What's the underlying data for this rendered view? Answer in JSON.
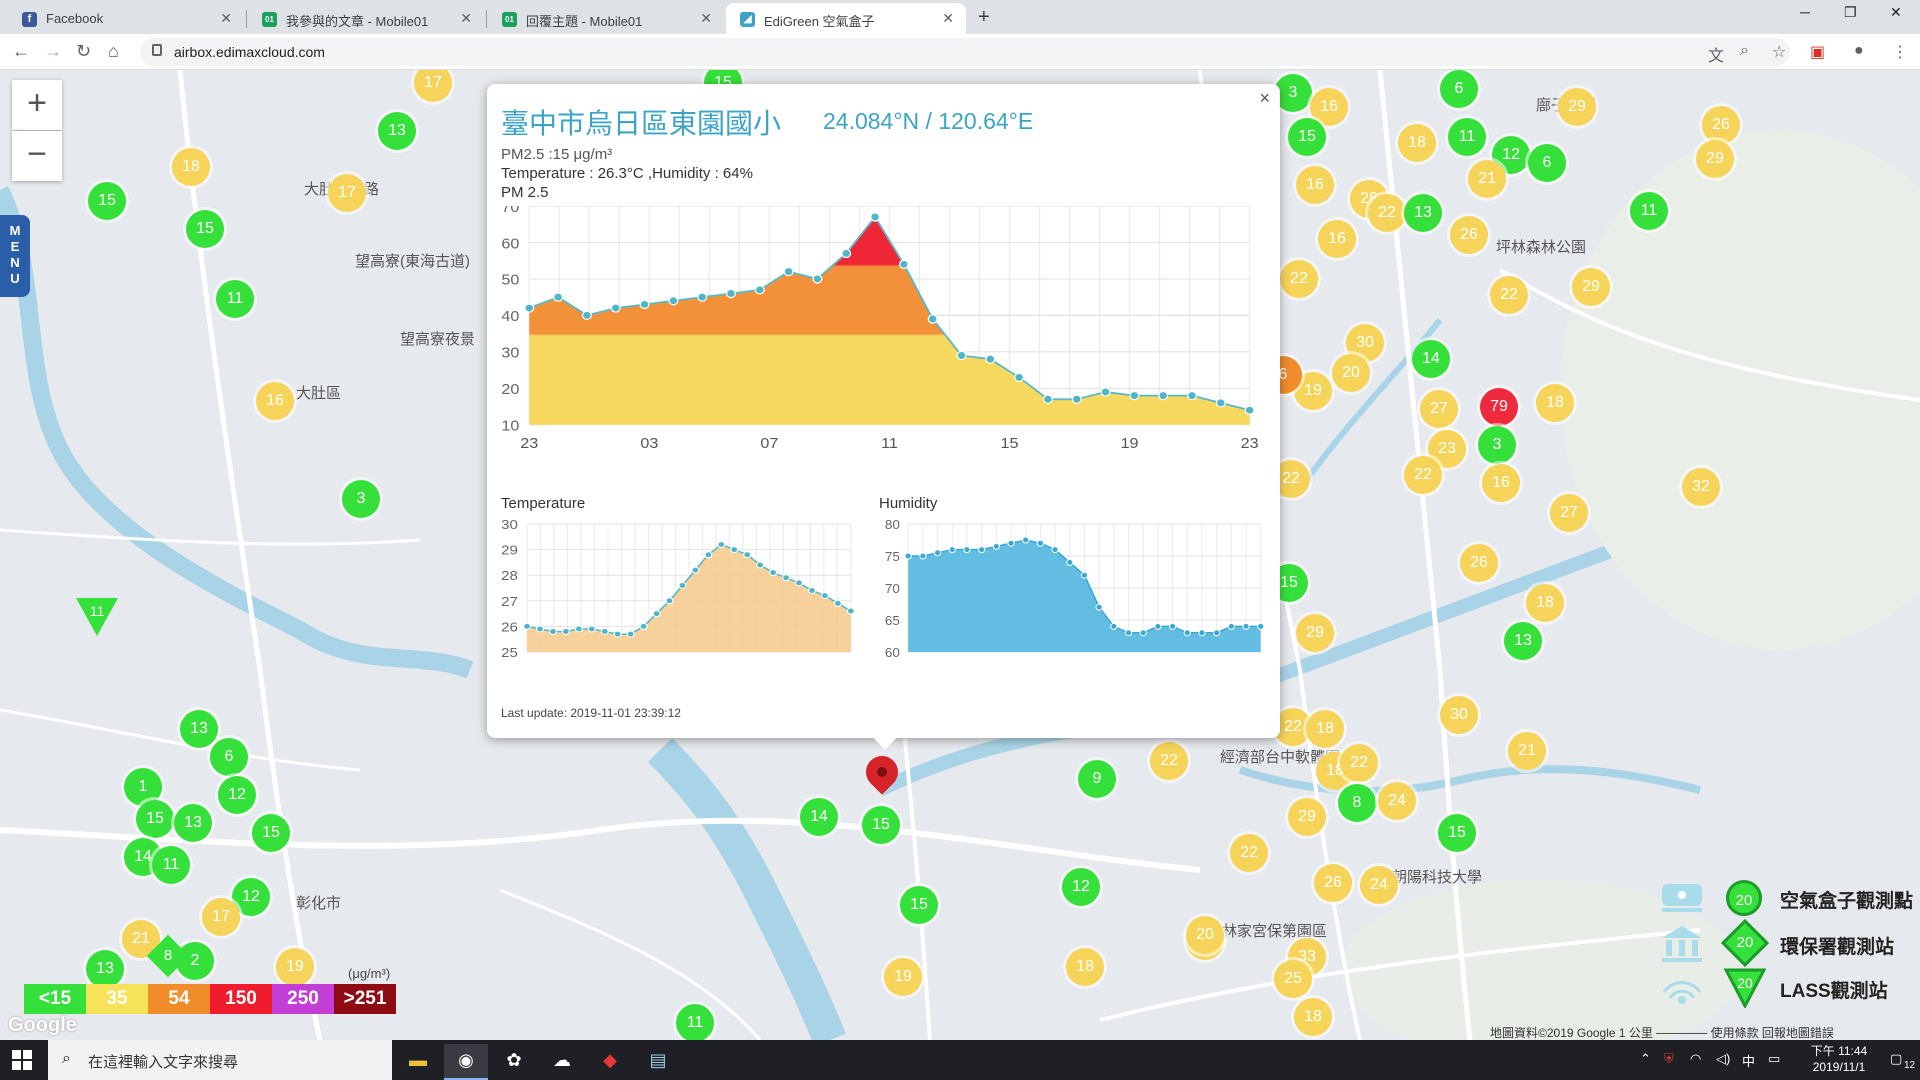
{
  "browser": {
    "tabs": [
      {
        "title": "Facebook",
        "icon": "facebook-icon",
        "color": "#3b5998",
        "glyph": "f"
      },
      {
        "title": "我參與的文章 - Mobile01",
        "icon": "mobile01-icon",
        "color": "#1aa05a",
        "glyph": "01"
      },
      {
        "title": "回覆主題 - Mobile01",
        "icon": "mobile01-icon",
        "color": "#1aa05a",
        "glyph": "01"
      },
      {
        "title": "EdiGreen 空氣盒子",
        "icon": "edigreen-icon",
        "color": "#3ba4c6",
        "glyph": "◢"
      }
    ],
    "url": "airbox.edimaxcloud.com"
  },
  "map": {
    "zoom_in": "+",
    "zoom_out": "−",
    "menu_label": "MENU",
    "places": [
      {
        "text": "大肚區"
      },
      {
        "text": "彰化市"
      },
      {
        "text": "望高寮(東海古道)"
      },
      {
        "text": "望高寮夜景"
      },
      {
        "text": "坪林森林公園"
      },
      {
        "text": "霧峰林家宮保第園區"
      },
      {
        "text": "廍子公園"
      },
      {
        "text": "經濟部台中軟體園"
      },
      {
        "text": "朝陽科技大學"
      },
      {
        "text": "大肚山公路"
      }
    ],
    "markers": [
      {
        "v": "17",
        "c": "y"
      },
      {
        "v": "13",
        "c": "g"
      },
      {
        "v": "18",
        "c": "y"
      },
      {
        "v": "17",
        "c": "y"
      },
      {
        "v": "15",
        "c": "g"
      },
      {
        "v": "15",
        "c": "g"
      },
      {
        "v": "11",
        "c": "g"
      },
      {
        "v": "16",
        "c": "y"
      },
      {
        "v": "3",
        "c": "g"
      },
      {
        "v": "13",
        "c": "g"
      },
      {
        "v": "6",
        "c": "g"
      },
      {
        "v": "1",
        "c": "g"
      },
      {
        "v": "12",
        "c": "g"
      },
      {
        "v": "15",
        "c": "g"
      },
      {
        "v": "13",
        "c": "g"
      },
      {
        "v": "15",
        "c": "g"
      },
      {
        "v": "14",
        "c": "g"
      },
      {
        "v": "11",
        "c": "g"
      },
      {
        "v": "12",
        "c": "g"
      },
      {
        "v": "17",
        "c": "y"
      },
      {
        "v": "21",
        "c": "y"
      },
      {
        "v": "2",
        "c": "g"
      },
      {
        "v": "19",
        "c": "y"
      },
      {
        "v": "13",
        "c": "g"
      },
      {
        "v": "11",
        "c": "g"
      },
      {
        "v": "14",
        "c": "g"
      },
      {
        "v": "15",
        "c": "g"
      },
      {
        "v": "15",
        "c": "g"
      },
      {
        "v": "19",
        "c": "y"
      },
      {
        "v": "12",
        "c": "g"
      },
      {
        "v": "9",
        "c": "g"
      },
      {
        "v": "22",
        "c": "y"
      },
      {
        "v": "18",
        "c": "y"
      },
      {
        "v": "20",
        "c": "y"
      },
      {
        "v": "3",
        "c": "g"
      },
      {
        "v": "16",
        "c": "y"
      },
      {
        "v": "15",
        "c": "g"
      },
      {
        "v": "16",
        "c": "y"
      },
      {
        "v": "28",
        "c": "y"
      },
      {
        "v": "22",
        "c": "y"
      },
      {
        "v": "13",
        "c": "g"
      },
      {
        "v": "16",
        "c": "y"
      },
      {
        "v": "22",
        "c": "y"
      },
      {
        "v": "30",
        "c": "y"
      },
      {
        "v": "20",
        "c": "y"
      },
      {
        "v": "19",
        "c": "y"
      },
      {
        "v": "6",
        "c": "o"
      },
      {
        "v": "22",
        "c": "y"
      },
      {
        "v": "29",
        "c": "y"
      },
      {
        "v": "15",
        "c": "g"
      },
      {
        "v": "22",
        "c": "y"
      },
      {
        "v": "18",
        "c": "y"
      },
      {
        "v": "18",
        "c": "y"
      },
      {
        "v": "22",
        "c": "y"
      },
      {
        "v": "29",
        "c": "y"
      },
      {
        "v": "8",
        "c": "g"
      },
      {
        "v": "24",
        "c": "y"
      },
      {
        "v": "22",
        "c": "y"
      },
      {
        "v": "26",
        "c": "y"
      },
      {
        "v": "24",
        "c": "y"
      },
      {
        "v": "15",
        "c": "g"
      },
      {
        "v": "30",
        "c": "y"
      },
      {
        "v": "21",
        "c": "y"
      },
      {
        "v": "20",
        "c": "y"
      },
      {
        "v": "33",
        "c": "y"
      },
      {
        "v": "25",
        "c": "y"
      },
      {
        "v": "18",
        "c": "y"
      },
      {
        "v": "6",
        "c": "g"
      },
      {
        "v": "11",
        "c": "g"
      },
      {
        "v": "18",
        "c": "y"
      },
      {
        "v": "12",
        "c": "g"
      },
      {
        "v": "6",
        "c": "g"
      },
      {
        "v": "21",
        "c": "y"
      },
      {
        "v": "29",
        "c": "y"
      },
      {
        "v": "26",
        "c": "y"
      },
      {
        "v": "11",
        "c": "g"
      },
      {
        "v": "26",
        "c": "y"
      },
      {
        "v": "22",
        "c": "y"
      },
      {
        "v": "29",
        "c": "y"
      },
      {
        "v": "14",
        "c": "g"
      },
      {
        "v": "27",
        "c": "y"
      },
      {
        "v": "79",
        "c": "r"
      },
      {
        "v": "18",
        "c": "y"
      },
      {
        "v": "23",
        "c": "y"
      },
      {
        "v": "3",
        "c": "g"
      },
      {
        "v": "22",
        "c": "y"
      },
      {
        "v": "16",
        "c": "y"
      },
      {
        "v": "32",
        "c": "y"
      },
      {
        "v": "27",
        "c": "y"
      },
      {
        "v": "26",
        "c": "y"
      },
      {
        "v": "18",
        "c": "y"
      },
      {
        "v": "13",
        "c": "g"
      },
      {
        "v": "29",
        "c": "y"
      },
      {
        "v": "15",
        "c": "g"
      }
    ],
    "diamonds": [
      {
        "v": "8"
      }
    ],
    "lass_triangles": [
      {
        "v": "11"
      }
    ],
    "aqi_legend": [
      {
        "label": "<15",
        "color": "#36e03a"
      },
      {
        "label": "35",
        "color": "#f6e35a"
      },
      {
        "label": "54",
        "color": "#f08c2a"
      },
      {
        "label": "150",
        "color": "#ee1c2c"
      },
      {
        "label": "250",
        "color": "#c23ed6"
      },
      {
        "label": ">251",
        "color": "#8e0b14"
      }
    ],
    "aqi_unit": "(μg/m³)",
    "google_logo": "Google",
    "attribution": "地圖資料©2019 Google   1 公里 ──────   使用條款   回報地圖錯誤",
    "station_legend": [
      {
        "icon": "airbox-device-icon",
        "value": "20",
        "label": "空氣盒子觀測點"
      },
      {
        "icon": "epa-building-icon",
        "value": "20",
        "label": "環保署觀測站"
      },
      {
        "icon": "lass-signal-icon",
        "value": "20",
        "label": "LASS觀測站"
      }
    ]
  },
  "popup": {
    "title": "臺中市烏日區東園國小",
    "coords": "24.084°N / 120.64°E",
    "pm_line": "PM2.5 :15 μg/m³",
    "temp_line": "Temperature : 26.3°C ,Humidity : 64%",
    "chart_title": "PM 2.5",
    "temp_title": "Temperature",
    "hum_title": "Humidity",
    "last_update": "Last update: 2019-11-01 23:39:12",
    "close": "×"
  },
  "chart_data": [
    {
      "type": "area",
      "title": "PM 2.5",
      "ylim": [
        10,
        70
      ],
      "yticks": [
        10,
        20,
        30,
        40,
        50,
        60,
        70
      ],
      "xtick_labels": [
        "23",
        "03",
        "07",
        "11",
        "15",
        "19",
        "23"
      ],
      "series": [
        {
          "values": [
            42,
            45,
            40,
            42,
            43,
            44,
            45,
            46,
            47,
            52,
            50,
            57,
            67,
            54,
            39,
            29,
            28,
            23,
            17,
            17,
            19,
            18,
            18,
            18,
            16,
            14
          ]
        }
      ],
      "thresholds": [
        {
          "value": 35,
          "color": "#f6d95e"
        },
        {
          "value": 54,
          "color": "#f3913a"
        },
        {
          "value": 70,
          "color": "#ee2636"
        }
      ]
    },
    {
      "type": "area",
      "title": "Temperature",
      "ylim": [
        25,
        30
      ],
      "yticks": [
        25,
        26,
        27,
        28,
        29,
        30
      ],
      "series": [
        {
          "values": [
            26.0,
            25.9,
            25.8,
            25.8,
            25.9,
            25.9,
            25.8,
            25.7,
            25.7,
            26.0,
            26.5,
            27.0,
            27.6,
            28.2,
            28.8,
            29.2,
            29.0,
            28.8,
            28.4,
            28.1,
            27.9,
            27.7,
            27.4,
            27.2,
            26.9,
            26.6
          ]
        }
      ],
      "fill": "#f6c98a"
    },
    {
      "type": "area",
      "title": "Humidity",
      "ylim": [
        60,
        80
      ],
      "yticks": [
        60,
        65,
        70,
        75,
        80
      ],
      "series": [
        {
          "values": [
            75,
            75,
            75.5,
            76,
            76,
            76,
            76.5,
            77,
            77.5,
            77,
            76,
            74,
            72,
            67,
            64,
            63,
            63,
            64,
            64,
            63,
            63,
            63,
            64,
            64,
            64
          ]
        }
      ],
      "fill": "#5bb8e0"
    }
  ],
  "taskbar": {
    "search_placeholder": "在這裡輸入文字來搜尋",
    "time": "下午 11:44",
    "date": "2019/11/1",
    "ime": "中",
    "notifications": "12"
  }
}
